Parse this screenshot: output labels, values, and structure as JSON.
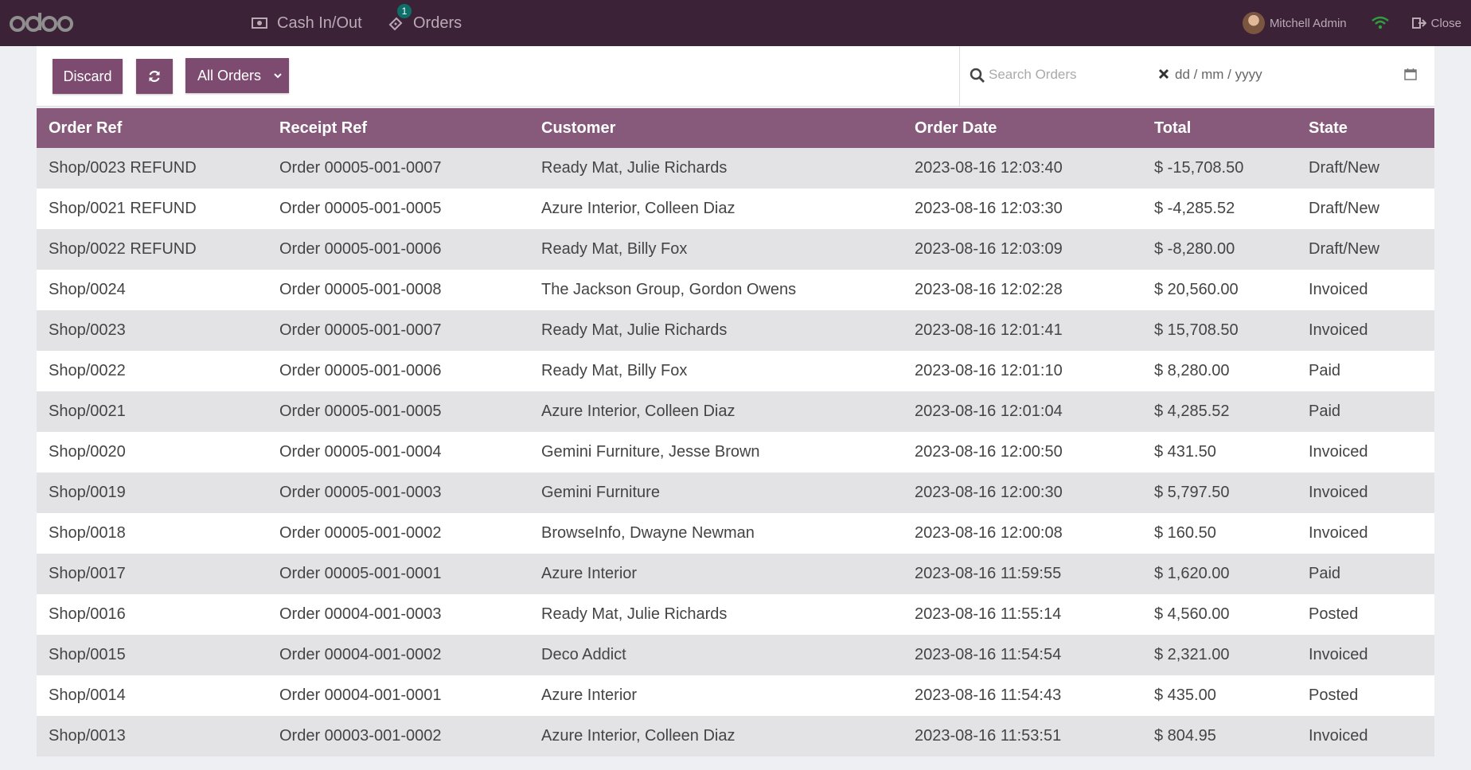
{
  "header": {
    "logo_text": "odoo",
    "cash_label": "Cash In/Out",
    "orders_label": "Orders",
    "orders_badge": "1",
    "user_name": "Mitchell Admin",
    "close_label": "Close"
  },
  "control": {
    "discard_label": "Discard",
    "filter_label": "All Orders",
    "search_placeholder": "Search Orders",
    "date_placeholder": "dd / mm / yyyy"
  },
  "table": {
    "columns": [
      "Order Ref",
      "Receipt Ref",
      "Customer",
      "Order Date",
      "Total",
      "State"
    ],
    "rows": [
      [
        "Shop/0023 REFUND",
        "Order 00005-001-0007",
        "Ready Mat, Julie Richards",
        "2023-08-16 12:03:40",
        "$ -15,708.50",
        "Draft/New"
      ],
      [
        "Shop/0021 REFUND",
        "Order 00005-001-0005",
        "Azure Interior, Colleen Diaz",
        "2023-08-16 12:03:30",
        "$ -4,285.52",
        "Draft/New"
      ],
      [
        "Shop/0022 REFUND",
        "Order 00005-001-0006",
        "Ready Mat, Billy Fox",
        "2023-08-16 12:03:09",
        "$ -8,280.00",
        "Draft/New"
      ],
      [
        "Shop/0024",
        "Order 00005-001-0008",
        "The Jackson Group, Gordon Owens",
        "2023-08-16 12:02:28",
        "$ 20,560.00",
        "Invoiced"
      ],
      [
        "Shop/0023",
        "Order 00005-001-0007",
        "Ready Mat, Julie Richards",
        "2023-08-16 12:01:41",
        "$ 15,708.50",
        "Invoiced"
      ],
      [
        "Shop/0022",
        "Order 00005-001-0006",
        "Ready Mat, Billy Fox",
        "2023-08-16 12:01:10",
        "$ 8,280.00",
        "Paid"
      ],
      [
        "Shop/0021",
        "Order 00005-001-0005",
        "Azure Interior, Colleen Diaz",
        "2023-08-16 12:01:04",
        "$ 4,285.52",
        "Paid"
      ],
      [
        "Shop/0020",
        "Order 00005-001-0004",
        "Gemini Furniture, Jesse Brown",
        "2023-08-16 12:00:50",
        "$ 431.50",
        "Invoiced"
      ],
      [
        "Shop/0019",
        "Order 00005-001-0003",
        "Gemini Furniture",
        "2023-08-16 12:00:30",
        "$ 5,797.50",
        "Invoiced"
      ],
      [
        "Shop/0018",
        "Order 00005-001-0002",
        "BrowseInfo, Dwayne Newman",
        "2023-08-16 12:00:08",
        "$ 160.50",
        "Invoiced"
      ],
      [
        "Shop/0017",
        "Order 00005-001-0001",
        "Azure Interior",
        "2023-08-16 11:59:55",
        "$ 1,620.00",
        "Paid"
      ],
      [
        "Shop/0016",
        "Order 00004-001-0003",
        "Ready Mat, Julie Richards",
        "2023-08-16 11:55:14",
        "$ 4,560.00",
        "Posted"
      ],
      [
        "Shop/0015",
        "Order 00004-001-0002",
        "Deco Addict",
        "2023-08-16 11:54:54",
        "$ 2,321.00",
        "Invoiced"
      ],
      [
        "Shop/0014",
        "Order 00004-001-0001",
        "Azure Interior",
        "2023-08-16 11:54:43",
        "$ 435.00",
        "Posted"
      ],
      [
        "Shop/0013",
        "Order 00003-001-0002",
        "Azure Interior, Colleen Diaz",
        "2023-08-16 11:53:51",
        "$ 804.95",
        "Invoiced"
      ]
    ]
  },
  "colors": {
    "topbar": "#3c2237",
    "primary": "#7d4a70",
    "table_header": "#875a7b",
    "wifi": "#2e9e3e"
  }
}
